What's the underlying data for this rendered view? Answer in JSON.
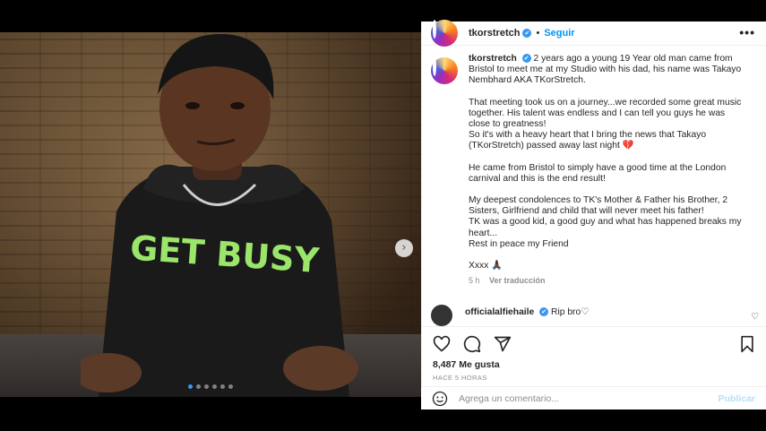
{
  "post": {
    "username": "tkorstretch",
    "verified_mark": "✔",
    "separator": "•",
    "follow_label": "Seguir",
    "more_icon": "more-horizontal-icon",
    "more_glyph": "•••",
    "image": {
      "shirt_text": "GET BUSY",
      "slides": 6,
      "active_slide": 1,
      "next_glyph": "›"
    }
  },
  "caption": {
    "author": "tkorstretch",
    "p1": "2 years ago a young 19 Year old man came from Bristol to meet me at my Studio with his dad, his name was Takayo Nembhard AKA TKorStretch.",
    "p2a": "That meeting took us on a journey...we recorded some great music together. His talent was endless and I can tell you guys he was close to greatness!",
    "p2b": "So it's with a heavy heart that I bring the news that Takayo (TKorStretch) passed away last night",
    "broken_heart": "💔",
    "p3": "He came from Bristol to simply have a good time at the London carnival and this is the end result!",
    "p4a": "My deepest condolences to TK's Mother & Father his Brother, 2 Sisters, Girlfriend and child that will never meet his father!",
    "p4b": "TK was a good kid, a good guy and what has happened breaks my heart...",
    "p4c": "Rest in peace my Friend",
    "signoff": "Xxxx",
    "signoff_emoji": "🙏🏿",
    "age": "5 h",
    "translate": "Ver traducción"
  },
  "comment": {
    "author": "officialalfiehaile",
    "text": "Rip bro♡",
    "like_glyph": "♡"
  },
  "actions": {
    "likes": "8,487 Me gusta",
    "time": "HACE 5 HORAS"
  },
  "add_comment": {
    "placeholder": "Agrega un comentario...",
    "post_label": "Publicar"
  },
  "colors": {
    "accent": "#0095f6",
    "verified": "#3897f0",
    "shirt_text": "#9be56a"
  }
}
